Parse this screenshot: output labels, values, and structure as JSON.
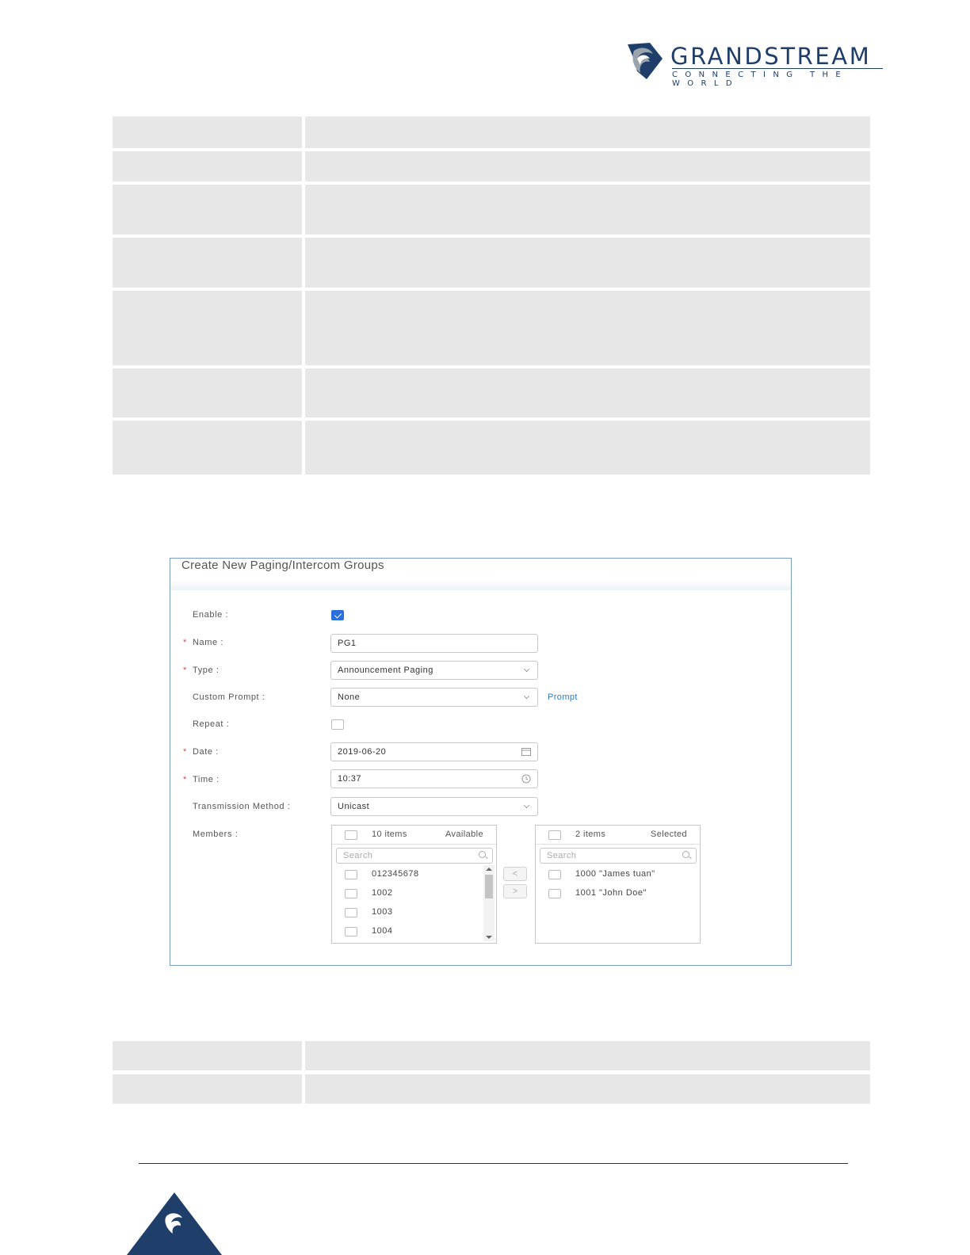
{
  "header": {
    "brand": "GRANDSTREAM",
    "tagline": "CONNECTING THE WORLD",
    "colors": {
      "brand_navy": "#1f3f6a",
      "brand_grey": "#9aa4ad"
    }
  },
  "dialog": {
    "title": "Create New Paging/Intercom Groups",
    "fields": {
      "enable": {
        "label": "Enable :",
        "checked": true
      },
      "name": {
        "label": "Name :",
        "value": "PG1",
        "required": true
      },
      "type": {
        "label": "Type :",
        "value": "Announcement Paging",
        "required": true
      },
      "custom_prompt": {
        "label": "Custom Prompt :",
        "value": "None",
        "link": "Prompt"
      },
      "repeat": {
        "label": "Repeat :",
        "checked": false
      },
      "date": {
        "label": "Date :",
        "value": "2019-06-20",
        "required": true
      },
      "time": {
        "label": "Time :",
        "value": "10:37",
        "required": true
      },
      "transmission_method": {
        "label": "Transmission Method :",
        "value": "Unicast"
      },
      "members": {
        "label": "Members :"
      }
    },
    "required_mark": "*",
    "available_list": {
      "count": "10 items",
      "title": "Available",
      "search_placeholder": "Search",
      "items": [
        "012345678",
        "1002",
        "1003",
        "1004"
      ]
    },
    "selected_list": {
      "count": "2 items",
      "title": "Selected",
      "search_placeholder": "Search",
      "items": [
        "1000 \"James tuan\"",
        "1001 \"John Doe\""
      ]
    },
    "move_left_label": "<",
    "move_right_label": ">",
    "colors": {
      "accent": "#2a6fdb",
      "link": "#2a7ad3",
      "required": "#e04444",
      "border": "#7a9cc6"
    }
  }
}
